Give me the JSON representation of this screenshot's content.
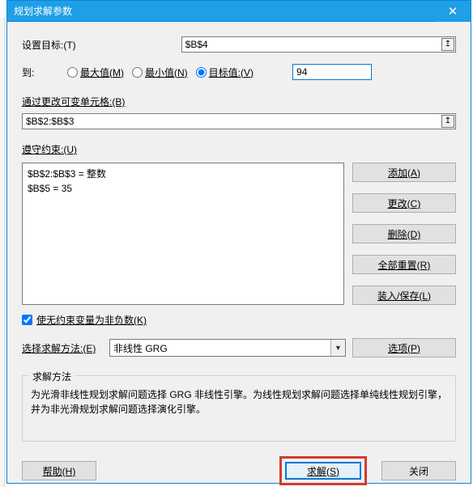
{
  "title": "规划求解参数",
  "labels": {
    "setTarget": "设置目标:(T)",
    "to": "到:",
    "max": "最大值(M)",
    "min": "最小值(N)",
    "targetVal": "目标值:(V)",
    "byChanging": "通过更改可变单元格:(B)",
    "subjectTo": "遵守约束:(U)",
    "nonneg": "使无约束变量为非负数(K)",
    "selectMethod": "选择求解方法:(E)",
    "groupTitle": "求解方法",
    "groupDesc": "为光滑非线性规划求解问题选择 GRG 非线性引擎。为线性规划求解问题选择单纯线性规划引擎，并为非光滑规划求解问题选择演化引擎。"
  },
  "values": {
    "target": "$B$4",
    "targetVal": "94",
    "vars": "$B$2:$B$3",
    "method": "非线性 GRG"
  },
  "constraints": [
    "$B$2:$B$3 = 整数",
    "$B$5 = 35"
  ],
  "buttons": {
    "add": "添加(A)",
    "change": "更改(C)",
    "delete": "删除(D)",
    "resetAll": "全部重置(R)",
    "loadSave": "装入/保存(L)",
    "options": "选项(P)",
    "help": "帮助(H)",
    "solve": "求解(S)",
    "close": "关闭"
  },
  "icons": {
    "close": "✕",
    "pick": "↥",
    "dropdown": "▼"
  }
}
